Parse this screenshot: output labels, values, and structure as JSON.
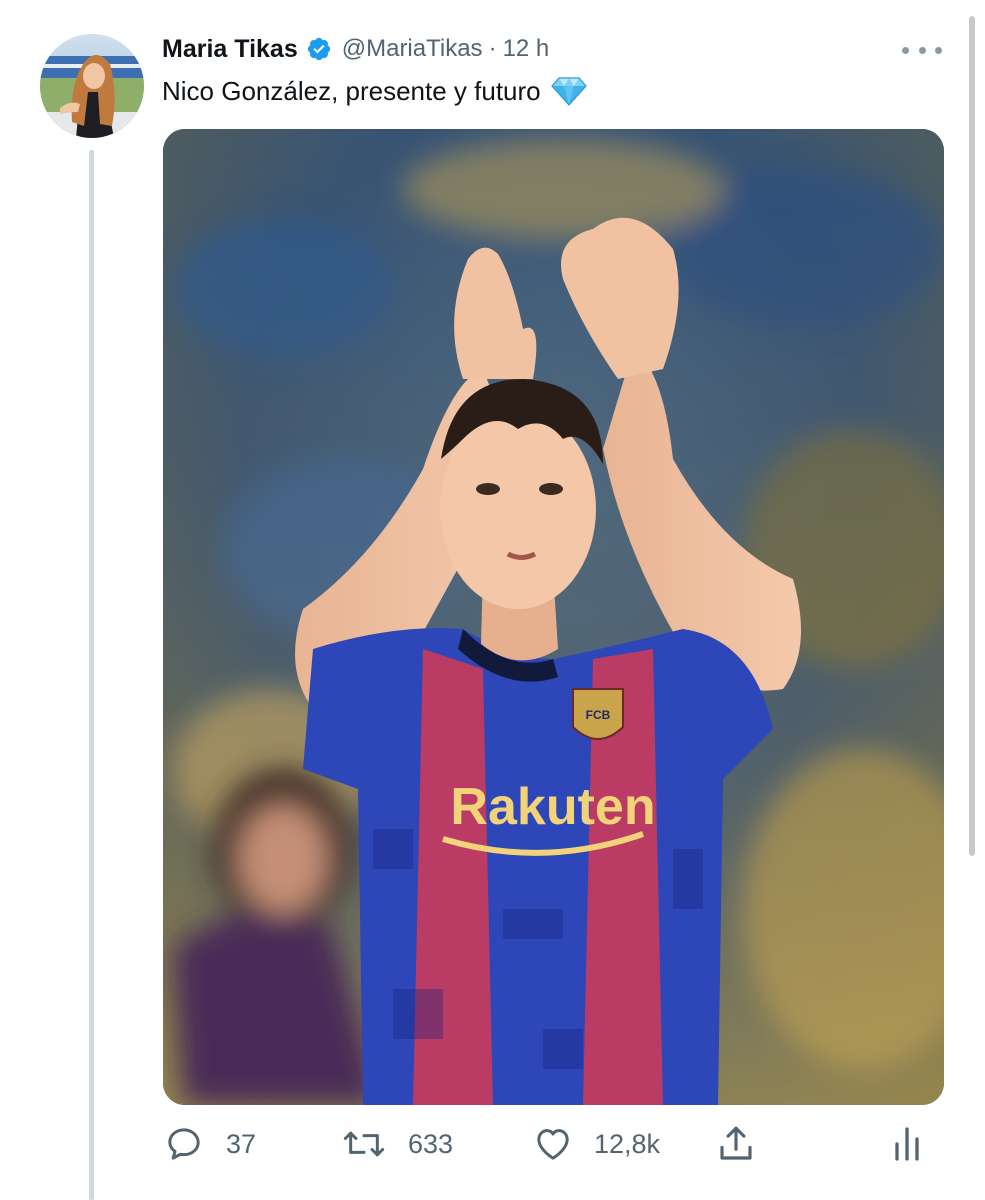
{
  "author": {
    "name": "Maria Tikas",
    "handle": "@MariaTikas",
    "separator": "·",
    "time": "12 h"
  },
  "tweet": {
    "text": "Nico González, presente y futuro"
  },
  "media": {
    "jersey_text": "Rakuten",
    "crest_text": "FCB"
  },
  "actions": {
    "replies": "37",
    "retweets": "633",
    "likes": "12,8k"
  },
  "colors": {
    "text_primary": "#0f1419",
    "text_secondary": "#536471",
    "verified_blue": "#1d9bf0",
    "thread_line": "#cfd9de"
  },
  "icons": {
    "verified": "verified-badge-icon",
    "more": "more-dots-icon",
    "gem": "gem-emoji-icon",
    "reply": "reply-icon",
    "retweet": "retweet-icon",
    "like": "heart-icon",
    "share": "share-icon",
    "analytics": "analytics-icon"
  }
}
